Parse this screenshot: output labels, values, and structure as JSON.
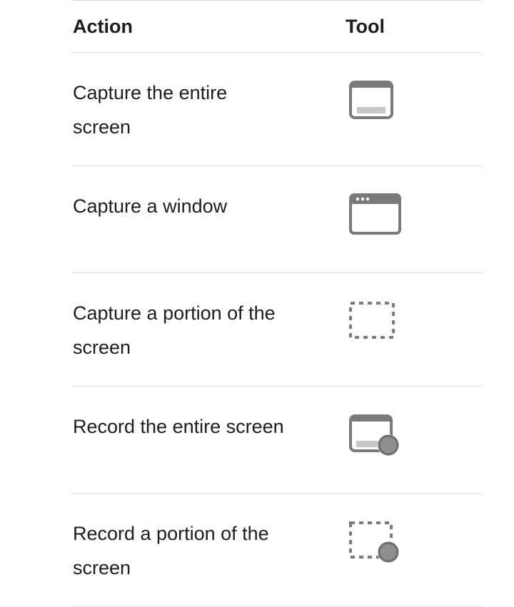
{
  "header": {
    "action_label": "Action",
    "tool_label": "Tool"
  },
  "rows": [
    {
      "action": "Capture the entire screen",
      "icon": "capture-entire-screen-icon"
    },
    {
      "action": "Capture a window",
      "icon": "capture-window-icon"
    },
    {
      "action": "Capture a portion of the screen",
      "icon": "capture-portion-icon"
    },
    {
      "action": "Record the entire screen",
      "icon": "record-entire-screen-icon"
    },
    {
      "action": "Record a portion of the screen",
      "icon": "record-portion-icon"
    }
  ],
  "colors": {
    "text": "#1d1d1f",
    "icon_stroke": "#7a7a7a",
    "icon_fill": "#8e8e8e",
    "divider": "#dcdcdc"
  }
}
